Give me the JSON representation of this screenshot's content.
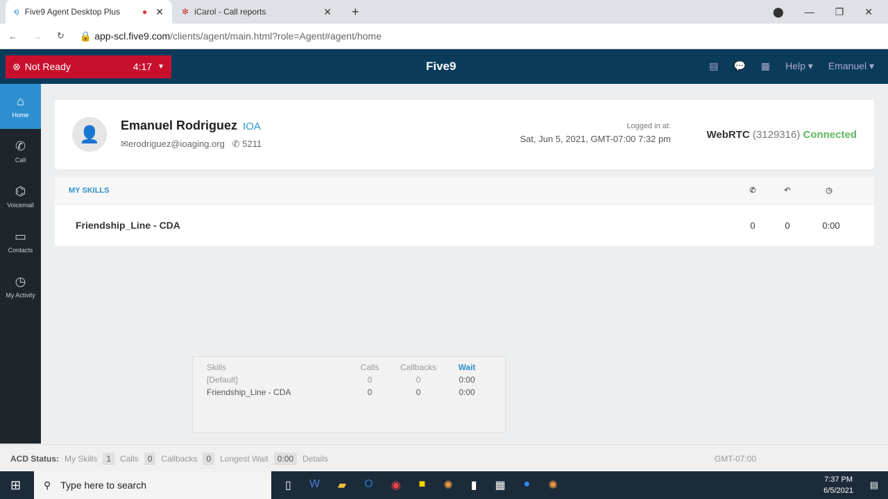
{
  "browser": {
    "tabs": [
      {
        "label": "Five9 Agent Desktop Plus"
      },
      {
        "label": "iCarol - Call reports"
      }
    ],
    "url_host": "app-scl.five9.com",
    "url_path": "/clients/agent/main.html?role=Agent#agent/home"
  },
  "topbar": {
    "status": "Not Ready",
    "timer": "4:17",
    "logo": "Five9",
    "help": "Help ▾",
    "user": "Emanuel ▾"
  },
  "sidebar": [
    {
      "label": "Home",
      "icon": "⌂"
    },
    {
      "label": "Call",
      "icon": "✆"
    },
    {
      "label": "Voicemail",
      "icon": "⌬"
    },
    {
      "label": "Contacts",
      "icon": "▭"
    },
    {
      "label": "My Activity",
      "icon": "◷"
    }
  ],
  "profile": {
    "name": "Emanuel Rodriguez",
    "org": "IOA",
    "email": "erodriguez@ioaging.org",
    "ext": "5211",
    "logged_label": "Logged in at:",
    "logged_time": "Sat, Jun 5, 2021, GMT-07:00 7:32 pm",
    "webrtc": "WebRTC",
    "webrtc_id": "(3129316)",
    "webrtc_status": "Connected"
  },
  "skills": {
    "title": "MY SKILLS",
    "rows": [
      {
        "name": "Friendship_Line - CDA",
        "calls": "0",
        "callbacks": "0",
        "wait": "0:00"
      }
    ]
  },
  "popup": {
    "headers": [
      "Skills",
      "Calls",
      "Callbacks",
      "Wait"
    ],
    "rows": [
      [
        "[Default]",
        "0",
        "0",
        "0:00"
      ],
      [
        "Friendship_Line - CDA",
        "0",
        "0",
        "0:00"
      ]
    ]
  },
  "acd": {
    "label": "ACD Status:",
    "my_skills": "My Skills",
    "my_skills_v": "1",
    "calls": "Calls",
    "calls_v": "0",
    "callbacks": "Callbacks",
    "callbacks_v": "0",
    "longest": "Longest Wait",
    "longest_v": "0:00",
    "details": "Details",
    "tz": "GMT-07:00"
  },
  "taskbar": {
    "search": "Type here to search",
    "time": "7:37 PM",
    "date": "6/5/2021"
  }
}
